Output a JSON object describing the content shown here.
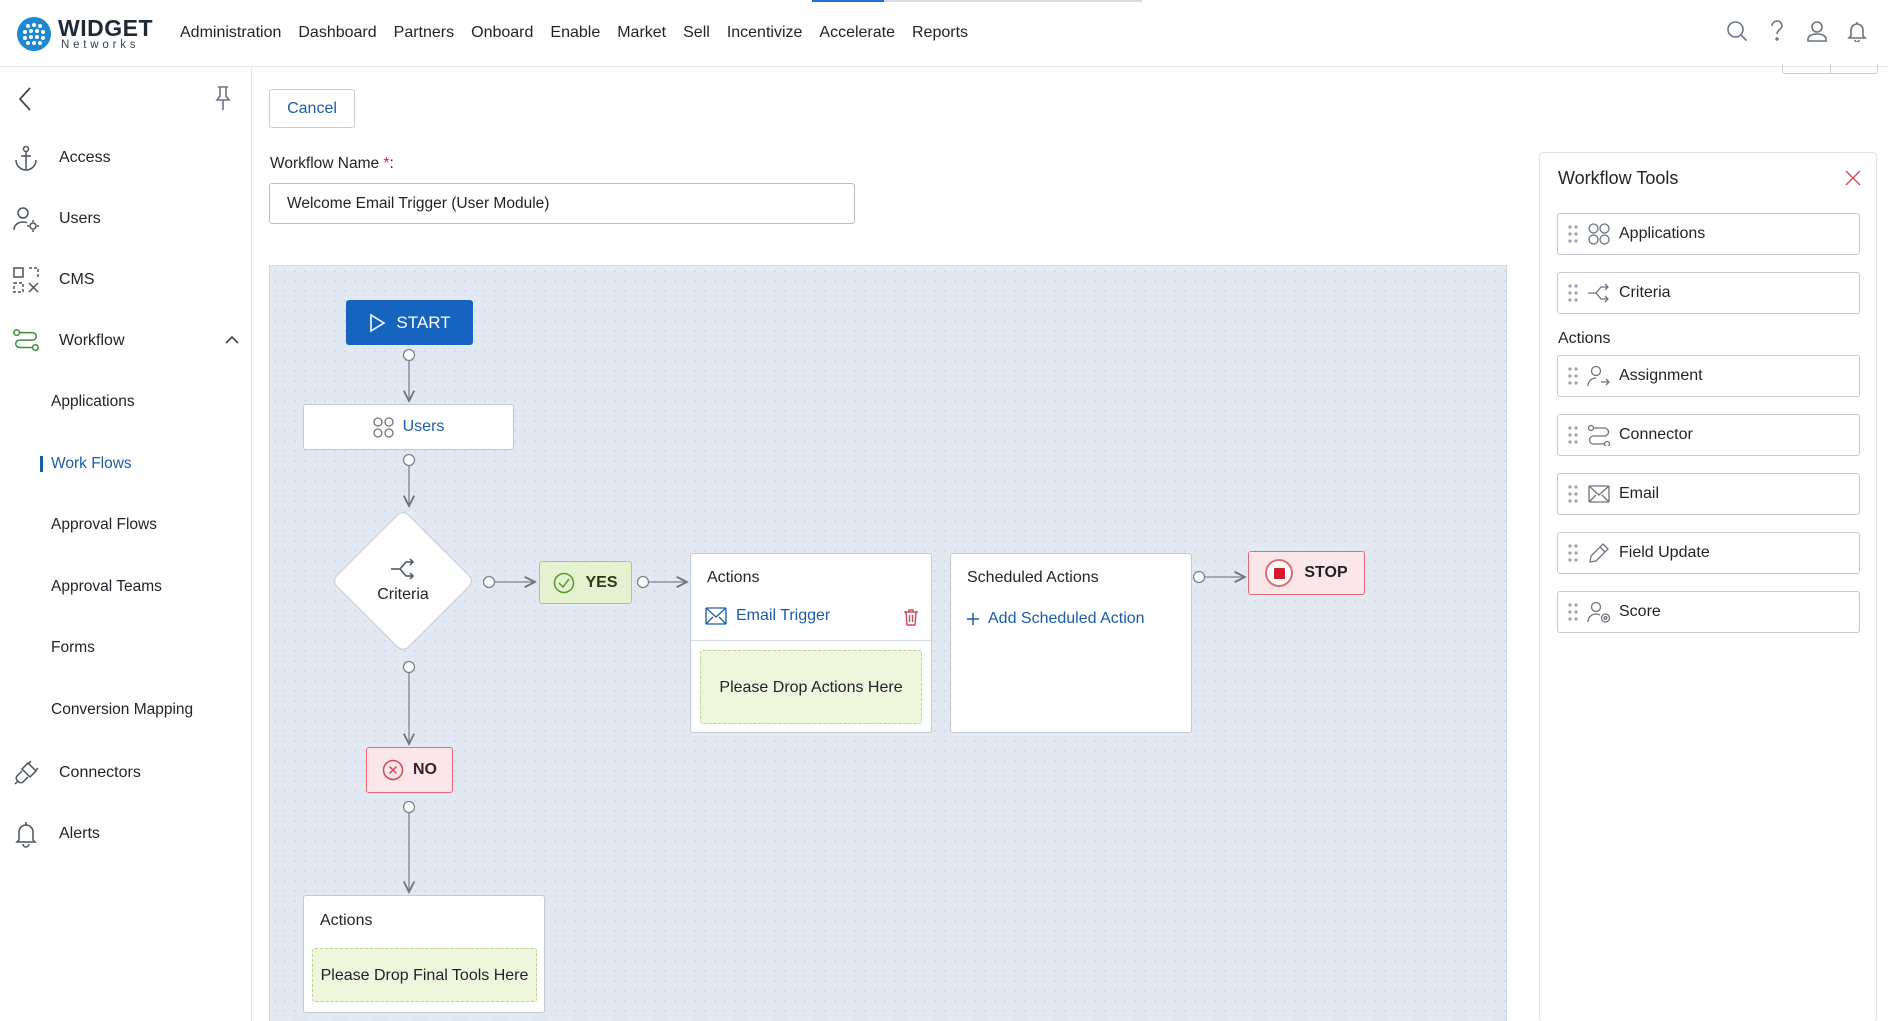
{
  "brand": {
    "name": "WIDGET",
    "sub": "Networks"
  },
  "topnav": {
    "items": [
      "Administration",
      "Dashboard",
      "Partners",
      "Onboard",
      "Enable",
      "Market",
      "Sell",
      "Incentivize",
      "Accelerate",
      "Reports"
    ],
    "icons": [
      "search-icon",
      "help-icon",
      "user-icon",
      "bell-icon"
    ]
  },
  "sidebar": {
    "items": [
      {
        "label": "Access",
        "icon": "anchor-icon"
      },
      {
        "label": "Users",
        "icon": "user-settings-icon"
      },
      {
        "label": "CMS",
        "icon": "cms-icon"
      },
      {
        "label": "Workflow",
        "icon": "workflow-icon",
        "expanded": true
      },
      {
        "label": "Connectors",
        "icon": "plug-icon"
      },
      {
        "label": "Alerts",
        "icon": "bell-icon"
      }
    ],
    "sub_items": [
      "Applications",
      "Work Flows",
      "Approval Flows",
      "Approval Teams",
      "Forms",
      "Conversion Mapping"
    ],
    "active_sub": "Work Flows"
  },
  "form": {
    "cancel_label": "Cancel",
    "name_label": "Workflow Name",
    "required_mark": "*",
    "label_suffix": ":",
    "name_value": "Welcome Email Trigger (User Module)"
  },
  "canvas": {
    "start_label": "START",
    "users_label": "Users",
    "criteria_label": "Criteria",
    "yes_label": "YES",
    "no_label": "NO",
    "stop_label": "STOP",
    "actions_title": "Actions",
    "email_trigger_label": "Email Trigger",
    "drop_actions_text": "Please Drop Actions Here",
    "scheduled_title": "Scheduled Actions",
    "add_scheduled_label": "Add Scheduled Action",
    "final_title": "Actions",
    "drop_final_text": "Please Drop Final Tools Here"
  },
  "tools": {
    "title": "Workflow Tools",
    "top_items": [
      {
        "label": "Applications",
        "icon": "apps-icon"
      },
      {
        "label": "Criteria",
        "icon": "branch-icon"
      }
    ],
    "section_label": "Actions",
    "action_items": [
      {
        "label": "Assignment",
        "icon": "assign-icon"
      },
      {
        "label": "Connector",
        "icon": "connector-icon"
      },
      {
        "label": "Email",
        "icon": "mail-icon"
      },
      {
        "label": "Field Update",
        "icon": "pencil-icon"
      },
      {
        "label": "Score",
        "icon": "score-icon"
      }
    ]
  },
  "colors": {
    "primary": "#1565c0",
    "link": "#1a5da8",
    "yes_bg": "#e4f2cf",
    "stop_border": "#e06c78",
    "canvas_bg": "#e3e9f2"
  }
}
